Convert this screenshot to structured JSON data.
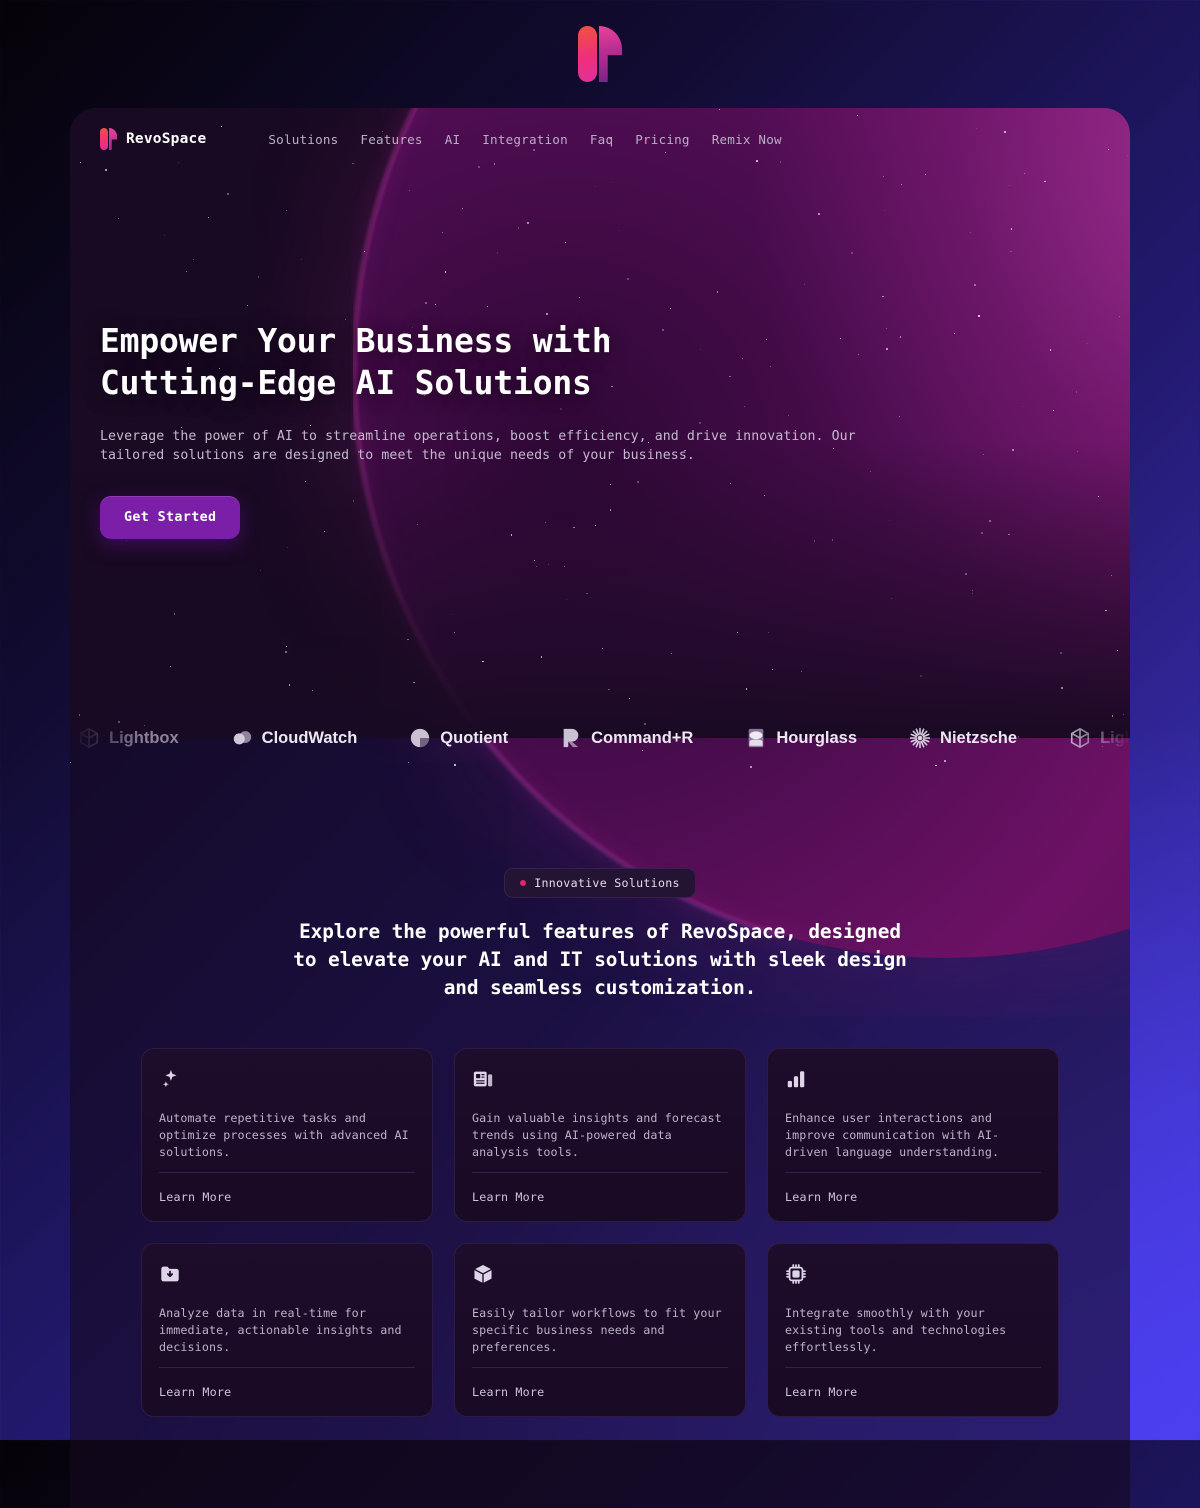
{
  "brand": {
    "name": "RevoSpace",
    "logo_icon": "revospace-logo-icon"
  },
  "nav": {
    "links": [
      {
        "label": "Solutions"
      },
      {
        "label": "Features"
      },
      {
        "label": "AI"
      },
      {
        "label": "Integration"
      },
      {
        "label": "Faq"
      },
      {
        "label": "Pricing"
      },
      {
        "label": "Remix Now"
      }
    ]
  },
  "hero": {
    "headline": "Empower Your Business with\nCutting-Edge AI Solutions",
    "subtext": "Leverage the power of AI to streamline operations, boost efficiency, and drive innovation. Our tailored solutions are designed to meet the unique needs of your business.",
    "cta_label": "Get Started"
  },
  "marquee": {
    "logos": [
      {
        "name": "Lightbox",
        "icon": "cube-icon",
        "dim": true
      },
      {
        "name": "CloudWatch",
        "icon": "cloud-icon",
        "dim": false
      },
      {
        "name": "Quotient",
        "icon": "circle-slice-icon",
        "dim": false
      },
      {
        "name": "Command+R",
        "icon": "command-icon",
        "dim": false
      },
      {
        "name": "Hourglass",
        "icon": "hourglass-icon",
        "dim": false
      },
      {
        "name": "Nietzsche",
        "icon": "sunburst-icon",
        "dim": false
      },
      {
        "name": "Lightbox",
        "icon": "cube-icon",
        "dim": false
      }
    ]
  },
  "features": {
    "badge_label": "Innovative Solutions",
    "title": "Explore the powerful features of RevoSpace, designed\nto elevate your AI and IT solutions with sleek design\nand seamless customization.",
    "cards": [
      {
        "icon": "sparkles-icon",
        "text": "Automate repetitive tasks and optimize processes with advanced AI solutions.",
        "link_label": "Learn More"
      },
      {
        "icon": "article-icon",
        "text": "Gain valuable insights and forecast trends using AI-powered data analysis tools.",
        "link_label": "Learn More"
      },
      {
        "icon": "bar-chart-icon",
        "text": "Enhance user interactions and improve communication with AI-driven language understanding.",
        "link_label": "Learn More"
      },
      {
        "icon": "folder-download-icon",
        "text": "Analyze data in real-time for immediate, actionable insights and decisions.",
        "link_label": "Learn More"
      },
      {
        "icon": "box-3d-icon",
        "text": "Easily tailor workflows to fit your specific business needs and preferences.",
        "link_label": "Learn More"
      },
      {
        "icon": "cpu-chip-icon",
        "text": "Integrate smoothly with your existing tools and technologies effortlessly.",
        "link_label": "Learn More"
      }
    ]
  },
  "colors": {
    "accent_pink": "#e0246e",
    "cta_purple": "#7c1fa8",
    "page_dark": "#190a23",
    "outer_blue": "#3a2db0",
    "card_border": "#2f1a42"
  }
}
